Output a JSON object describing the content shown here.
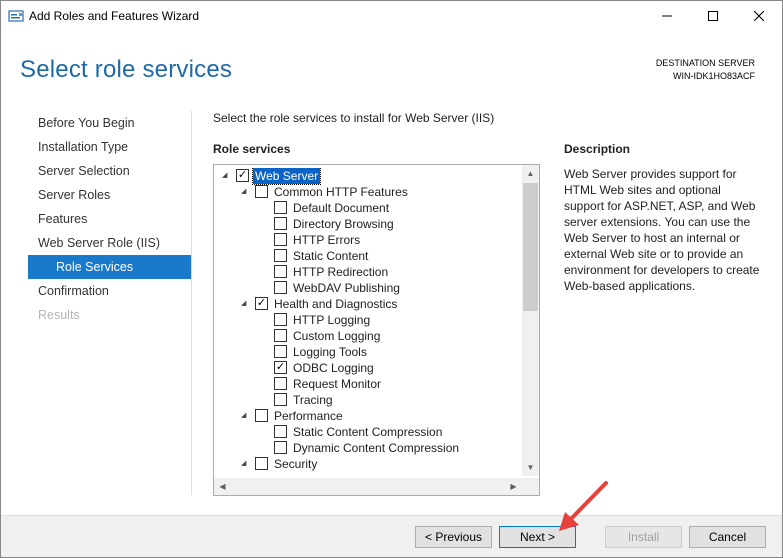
{
  "window": {
    "title": "Add Roles and Features Wizard",
    "icon": "server-manager-icon",
    "controls": {
      "minimize": "minimize-icon",
      "maximize": "maximize-icon",
      "close": "close-icon"
    }
  },
  "header": {
    "page_title": "Select role services",
    "destination_label": "DESTINATION SERVER",
    "destination_value": "WIN-IDK1HO83ACF"
  },
  "nav": {
    "items": [
      {
        "label": "Before You Begin",
        "state": "normal"
      },
      {
        "label": "Installation Type",
        "state": "normal"
      },
      {
        "label": "Server Selection",
        "state": "normal"
      },
      {
        "label": "Server Roles",
        "state": "normal"
      },
      {
        "label": "Features",
        "state": "normal"
      },
      {
        "label": "Web Server Role (IIS)",
        "state": "normal"
      },
      {
        "label": "Role Services",
        "state": "active"
      },
      {
        "label": "Confirmation",
        "state": "normal"
      },
      {
        "label": "Results",
        "state": "disabled"
      }
    ]
  },
  "main": {
    "instruction": "Select the role services to install for Web Server (IIS)",
    "role_services_label": "Role services",
    "tree": [
      {
        "label": "Web Server",
        "level": 0,
        "expanded": true,
        "checked": true,
        "selected": true
      },
      {
        "label": "Common HTTP Features",
        "level": 1,
        "expanded": true,
        "checked": false
      },
      {
        "label": "Default Document",
        "level": 2,
        "checked": false
      },
      {
        "label": "Directory Browsing",
        "level": 2,
        "checked": false
      },
      {
        "label": "HTTP Errors",
        "level": 2,
        "checked": false
      },
      {
        "label": "Static Content",
        "level": 2,
        "checked": false
      },
      {
        "label": "HTTP Redirection",
        "level": 2,
        "checked": false
      },
      {
        "label": "WebDAV Publishing",
        "level": 2,
        "checked": false
      },
      {
        "label": "Health and Diagnostics",
        "level": 1,
        "expanded": true,
        "checked": true
      },
      {
        "label": "HTTP Logging",
        "level": 2,
        "checked": false
      },
      {
        "label": "Custom Logging",
        "level": 2,
        "checked": false
      },
      {
        "label": "Logging Tools",
        "level": 2,
        "checked": false
      },
      {
        "label": "ODBC Logging",
        "level": 2,
        "checked": true
      },
      {
        "label": "Request Monitor",
        "level": 2,
        "checked": false
      },
      {
        "label": "Tracing",
        "level": 2,
        "checked": false
      },
      {
        "label": "Performance",
        "level": 1,
        "expanded": true,
        "checked": false
      },
      {
        "label": "Static Content Compression",
        "level": 2,
        "checked": false
      },
      {
        "label": "Dynamic Content Compression",
        "level": 2,
        "checked": false
      },
      {
        "label": "Security",
        "level": 1,
        "expanded": true,
        "checked": false
      }
    ],
    "description_label": "Description",
    "description_text": "Web Server provides support for HTML Web sites and optional support for ASP.NET, ASP, and Web server extensions. You can use the Web Server to host an internal or external Web site or to provide an environment for developers to create Web-based applications."
  },
  "footer": {
    "previous": "< Previous",
    "next": "Next >",
    "install": "Install",
    "cancel": "Cancel",
    "annotation_arrow_color": "#e8413c"
  },
  "colors": {
    "title_blue": "#1e6aa8",
    "nav_active": "#1979ca",
    "selection": "#0a64c8"
  }
}
